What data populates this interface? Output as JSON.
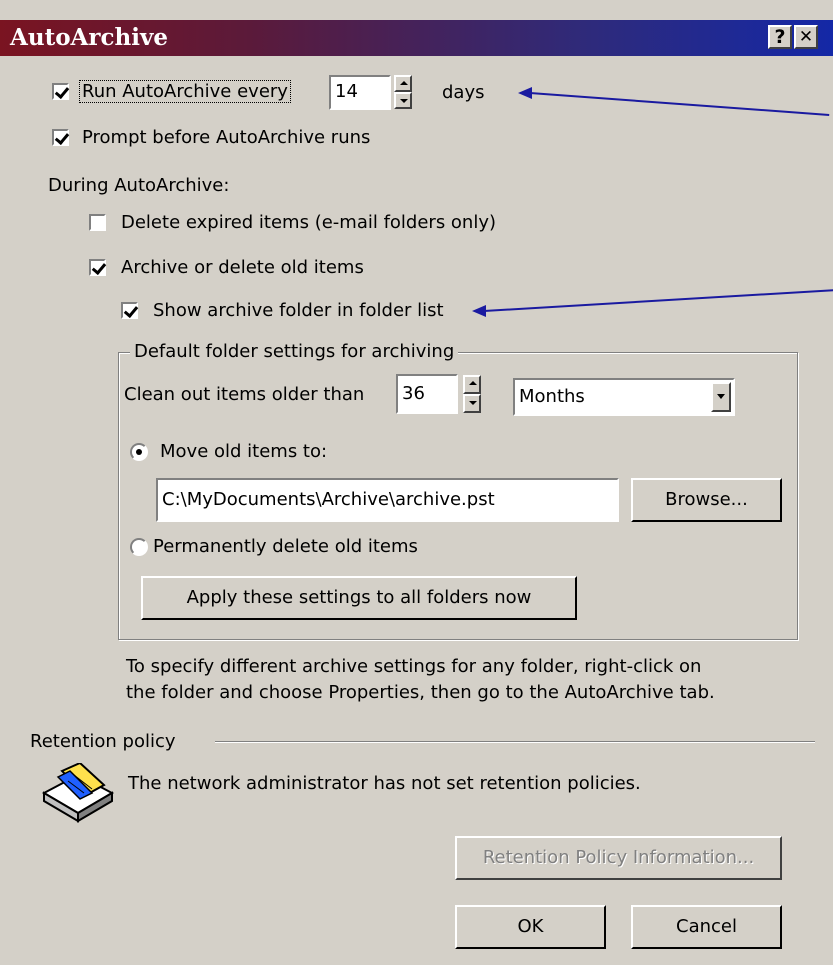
{
  "window": {
    "title": "AutoArchive",
    "help_label": "?",
    "close_label": "✕"
  },
  "run_autoarchive": {
    "label": "Run AutoArchive every",
    "checked": true,
    "days_value": "14",
    "days_label": "days"
  },
  "prompt_before": {
    "label": "Prompt before AutoArchive runs",
    "checked": true
  },
  "during_label": "During AutoArchive:",
  "delete_expired": {
    "label": "Delete expired items (e-mail folders only)",
    "checked": false
  },
  "archive_old": {
    "label": "Archive or delete old items",
    "checked": true
  },
  "show_archive_folder": {
    "label": "Show archive folder in folder list",
    "checked": true
  },
  "default_settings": {
    "legend": "Default folder settings for archiving",
    "clean_out_label": "Clean out items older than",
    "clean_out_value": "36",
    "period_value": "Months",
    "move_label": "Move old items to:",
    "move_selected": true,
    "path_value": "C:\\MyDocuments\\Archive\\archive.pst",
    "browse_label": "Browse...",
    "delete_label": "Permanently delete old items",
    "apply_label": "Apply these settings to all folders now"
  },
  "info_text_line1": "To specify different archive settings for any folder, right-click on",
  "info_text_line2": "the folder and choose Properties, then go to the AutoArchive tab.",
  "retention": {
    "label": "Retention policy",
    "message": "The network administrator has not set retention policies.",
    "info_button": "Retention Policy Information..."
  },
  "buttons": {
    "ok": "OK",
    "cancel": "Cancel"
  },
  "colors": {
    "title_start": "#7a1421",
    "title_end": "#1428a6",
    "face": "#d4d0c8",
    "arrow": "#1a1aa0"
  }
}
